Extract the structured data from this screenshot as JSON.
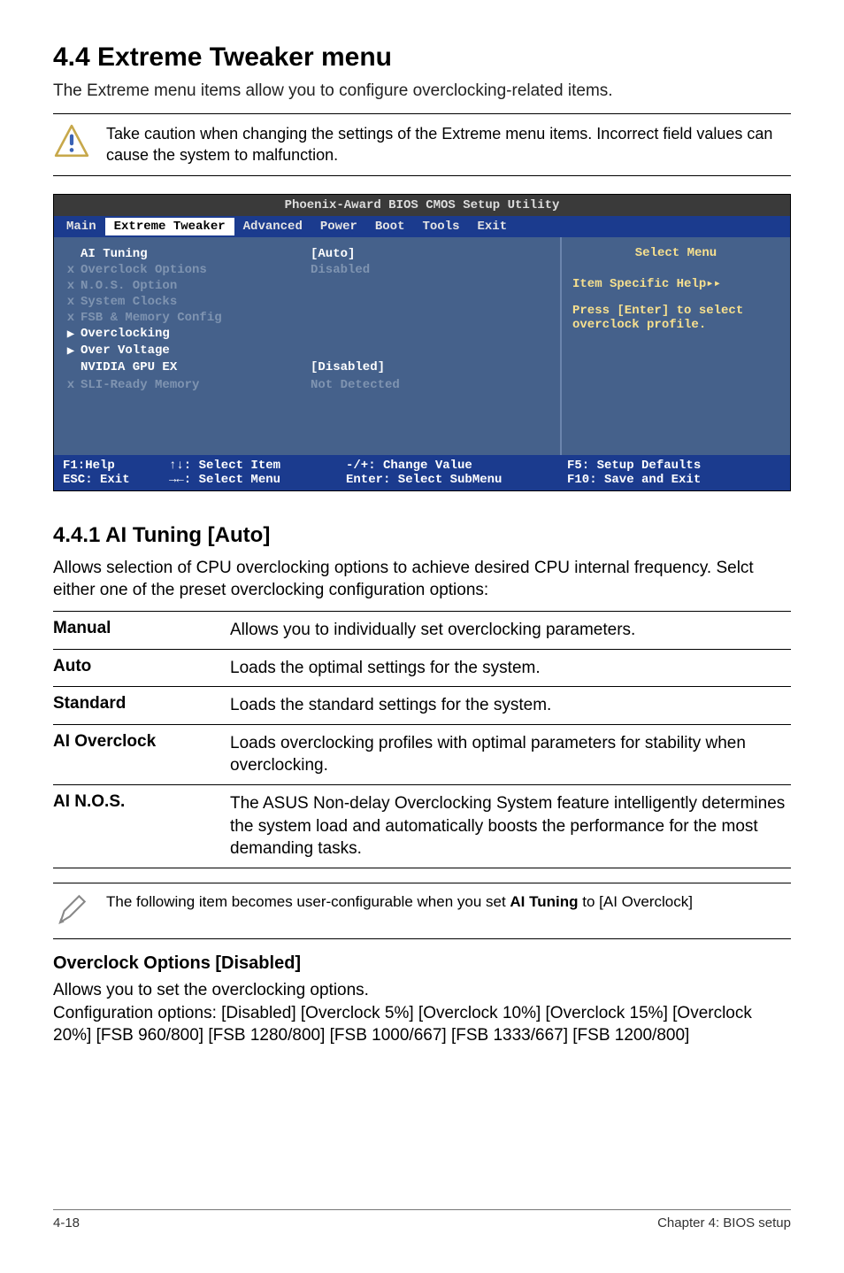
{
  "header": {
    "title": "4.4     Extreme Tweaker menu",
    "intro": "The Extreme menu items allow you to configure overclocking-related items."
  },
  "note1": "Take caution when changing the settings of the Extreme menu items. Incorrect field values can cause the system to malfunction.",
  "bios": {
    "title": "Phoenix-Award BIOS CMOS Setup Utility",
    "menu": [
      "Main",
      "Extreme Tweaker",
      "Advanced",
      "Power",
      "Boot",
      "Tools",
      "Exit"
    ],
    "items": [
      {
        "marker": "",
        "label": "AI Tuning",
        "value": "[Auto]",
        "active": true
      },
      {
        "marker": "x",
        "label": "Overclock Options",
        "value": "Disabled",
        "active": false
      },
      {
        "marker": "x",
        "label": "N.O.S. Option",
        "value": "",
        "active": false
      },
      {
        "marker": "x",
        "label": "System Clocks",
        "value": "",
        "active": false
      },
      {
        "marker": "x",
        "label": "FSB & Memory Config",
        "value": "",
        "active": false
      },
      {
        "marker": "▶",
        "label": "Overclocking",
        "value": "",
        "active": true,
        "markerWhite": true
      },
      {
        "marker": "▶",
        "label": "Over Voltage",
        "value": "",
        "active": true,
        "markerWhite": true
      },
      {
        "marker": "",
        "label": "NVIDIA GPU EX",
        "value": "[Disabled]",
        "active": true
      },
      {
        "marker": "",
        "label": "",
        "value": "",
        "active": false
      },
      {
        "marker": "x",
        "label": "SLI-Ready Memory",
        "value": "Not Detected",
        "active": false
      }
    ],
    "help": {
      "title": "Select Menu",
      "line1": "Item Specific Help▸▸",
      "line2": "Press [Enter] to select overclock profile."
    },
    "footer": {
      "c1a": "F1:Help",
      "c2a": "↑↓: Select Item",
      "c3a": "-/+: Change Value",
      "c4a": "F5: Setup Defaults",
      "c1b": "ESC: Exit",
      "c2b": "→←: Select Menu",
      "c3b": "Enter: Select SubMenu",
      "c4b": "F10: Save and Exit"
    }
  },
  "section": {
    "heading": "4.4.1      AI Tuning [Auto]",
    "para": "Allows selection of CPU overclocking options to achieve desired CPU internal frequency. Selct either one of the preset overclocking configuration options:",
    "defs": [
      {
        "term": "Manual",
        "desc": "Allows you to individually set overclocking parameters."
      },
      {
        "term": "Auto",
        "desc": "Loads the optimal settings for the system."
      },
      {
        "term": "Standard",
        "desc": "Loads the standard settings for the system."
      },
      {
        "term": "AI Overclock",
        "desc": "Loads overclocking profiles with optimal parameters for stability when overclocking."
      },
      {
        "term": "AI N.O.S.",
        "desc": "The ASUS Non-delay Overclocking System feature intelligently determines the system load and automatically boosts the performance for the most demanding tasks."
      }
    ]
  },
  "note2_pre": "The following item becomes user-configurable when you set ",
  "note2_bold": "AI Tuning",
  "note2_post": " to [AI Overclock]",
  "overclock": {
    "heading": "Overclock Options [Disabled]",
    "p1": "Allows you to set the overclocking options.",
    "p2": "Configuration options: [Disabled] [Overclock 5%] [Overclock 10%] [Overclock 15%] [Overclock 20%] [FSB 960/800] [FSB 1280/800] [FSB 1000/667] [FSB 1333/667] [FSB 1200/800]"
  },
  "footer": {
    "left": "4-18",
    "right": "Chapter 4: BIOS setup"
  }
}
